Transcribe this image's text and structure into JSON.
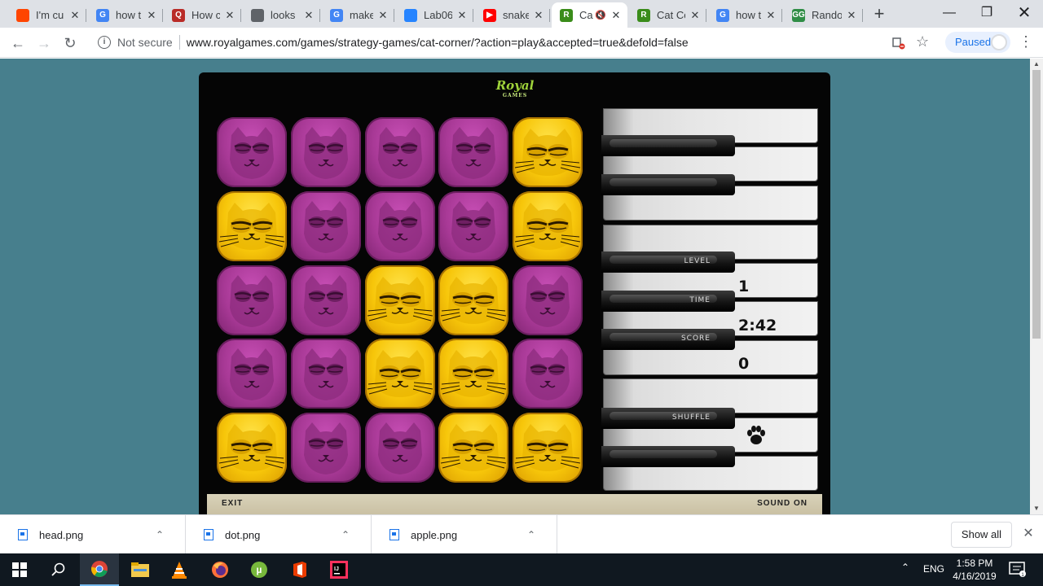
{
  "browser": {
    "tabs": [
      {
        "title": "I'm cu",
        "favicon": "reddit-icon",
        "color": "#ff4500",
        "glyph": ""
      },
      {
        "title": "how t",
        "favicon": "google-icon",
        "color": "#4285f4",
        "glyph": "G"
      },
      {
        "title": "How c",
        "favicon": "quora-icon",
        "color": "#b92b27",
        "glyph": "Q"
      },
      {
        "title": "looks",
        "favicon": "page-icon",
        "color": "#5f6368",
        "glyph": ""
      },
      {
        "title": "make",
        "favicon": "google-icon",
        "color": "#4285f4",
        "glyph": "G"
      },
      {
        "title": "Lab06",
        "favicon": "jira-icon",
        "color": "#2684ff",
        "glyph": ""
      },
      {
        "title": "snake",
        "favicon": "youtube-icon",
        "color": "#ff0000",
        "glyph": "▶"
      },
      {
        "title": "Ca",
        "favicon": "royalgames-icon",
        "color": "#3a8c1a",
        "glyph": "R",
        "active": true,
        "muted": true
      },
      {
        "title": "Cat Co",
        "favicon": "royalgames-icon",
        "color": "#3a8c1a",
        "glyph": "R"
      },
      {
        "title": "how t",
        "favicon": "google-icon",
        "color": "#4285f4",
        "glyph": "G"
      },
      {
        "title": "Rando",
        "favicon": "geeksforgeeks-icon",
        "color": "#2f8d46",
        "glyph": "GG"
      }
    ],
    "not_secure": "Not secure",
    "url": "www.royalgames.com/games/strategy-games/cat-corner/?action=play&accepted=true&defold=false",
    "profile_status": "Paused"
  },
  "game": {
    "logo_text": "Royal",
    "logo_sub": "GAMES",
    "grid": [
      [
        "purple",
        "purple",
        "purple",
        "purple",
        "yellow"
      ],
      [
        "yellow",
        "purple",
        "purple",
        "purple",
        "yellow"
      ],
      [
        "purple",
        "purple",
        "yellow",
        "yellow",
        "purple"
      ],
      [
        "purple",
        "purple",
        "yellow",
        "yellow",
        "purple"
      ],
      [
        "yellow",
        "purple",
        "purple",
        "yellow",
        "yellow"
      ]
    ],
    "panel": {
      "level_label": "LEVEL",
      "level_value": "1",
      "time_label": "TIME",
      "time_value": "2:42",
      "score_label": "SCORE",
      "score_value": "0",
      "shuffle_label": "SHUFFLE",
      "shuffle_icon": "paw-icon"
    },
    "exit_label": "EXIT",
    "sound_label": "SOUND ON",
    "colors": {
      "purple": "#a83996",
      "yellow": "#f7c60a",
      "background": "#477f8d"
    }
  },
  "downloads": {
    "items": [
      "head.png",
      "dot.png",
      "apple.png"
    ],
    "show_all": "Show all"
  },
  "taskbar": {
    "apps": [
      "start-icon",
      "search-icon",
      "chrome-icon",
      "file-explorer-icon",
      "vlc-icon",
      "firefox-icon",
      "utorrent-icon",
      "office-icon",
      "intellij-icon"
    ],
    "language": "ENG",
    "time": "1:58 PM",
    "date": "4/16/2019"
  }
}
